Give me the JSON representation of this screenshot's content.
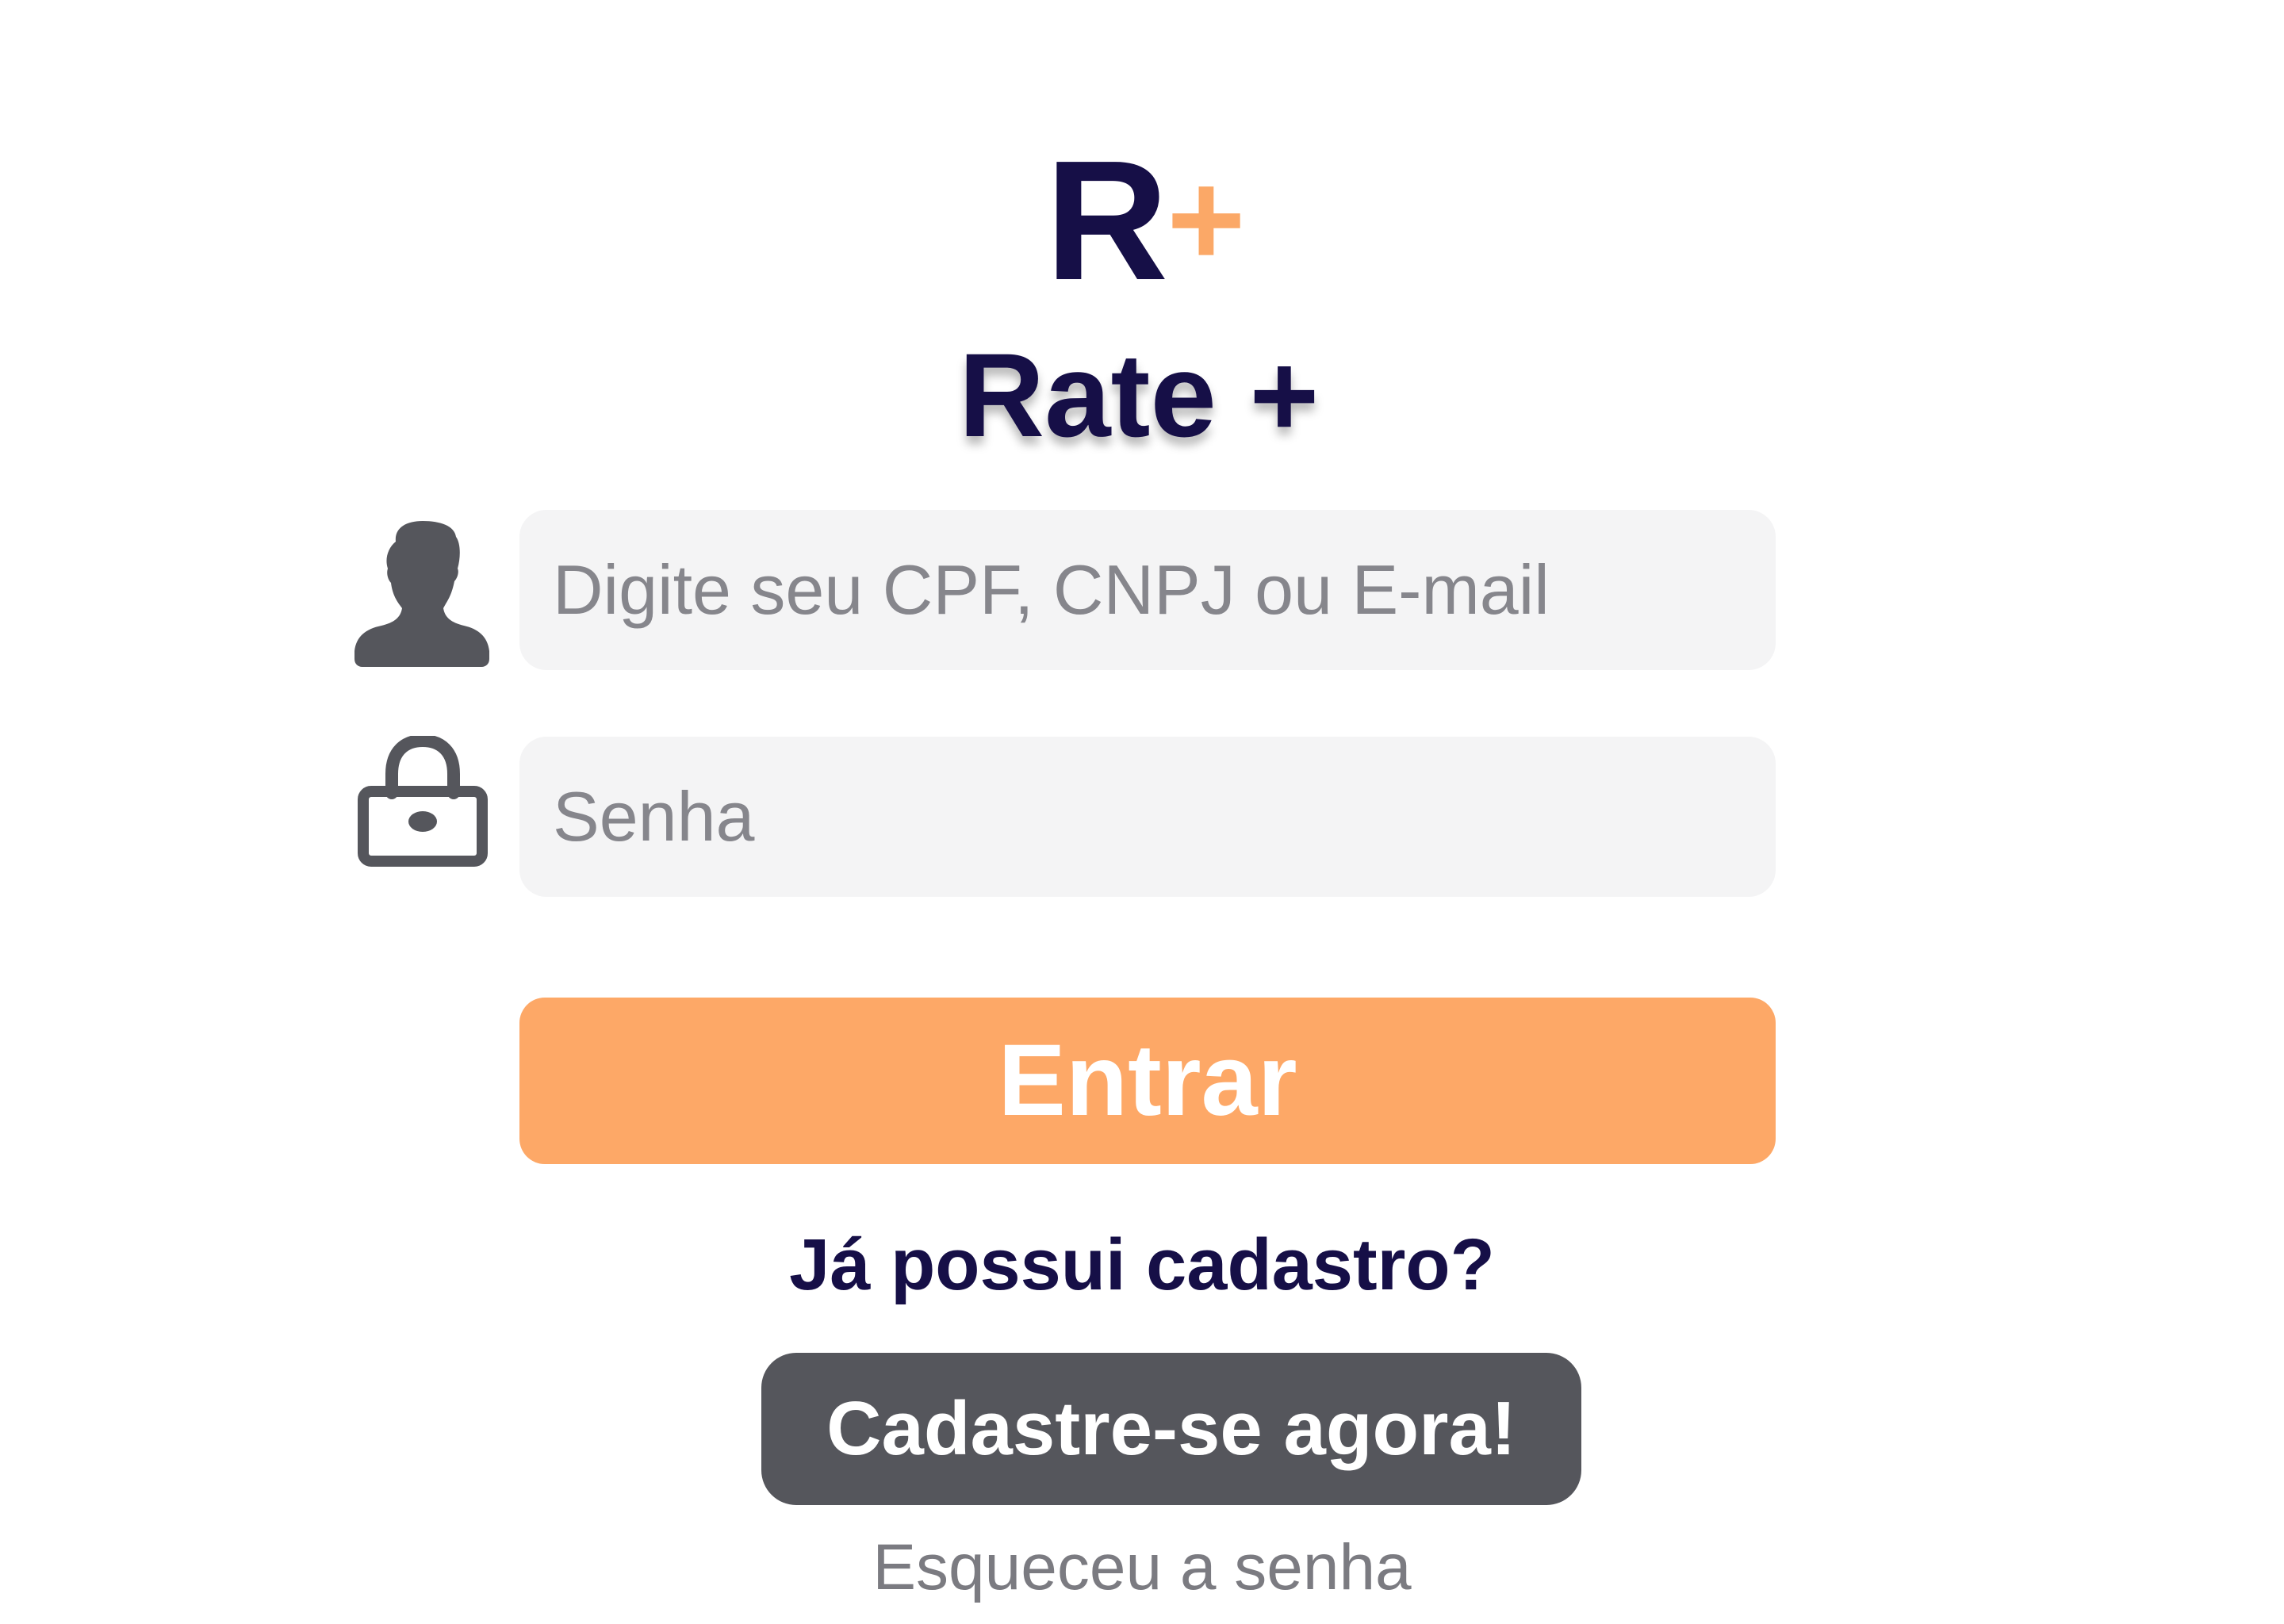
{
  "logo": {
    "letter": "R",
    "plus": "+"
  },
  "app_title": "Rate +",
  "login": {
    "user_icon": "user-silhouette-icon",
    "user_placeholder": "Digite seu CPF, CNPJ ou E-mail",
    "user_value": "",
    "password_icon": "padlock-icon",
    "password_placeholder": "Senha",
    "password_value": "",
    "submit_label": "Entrar"
  },
  "signup": {
    "question": "Já possui cadastro?",
    "button_label": "Cadastre-se agora!"
  },
  "forgot_password": "Esqueceu a senha",
  "colors": {
    "brand_navy": "#160f47",
    "accent_orange": "#fda867",
    "icon_gray": "#55565c",
    "field_bg": "#f4f4f5",
    "placeholder_gray": "#86868c"
  }
}
